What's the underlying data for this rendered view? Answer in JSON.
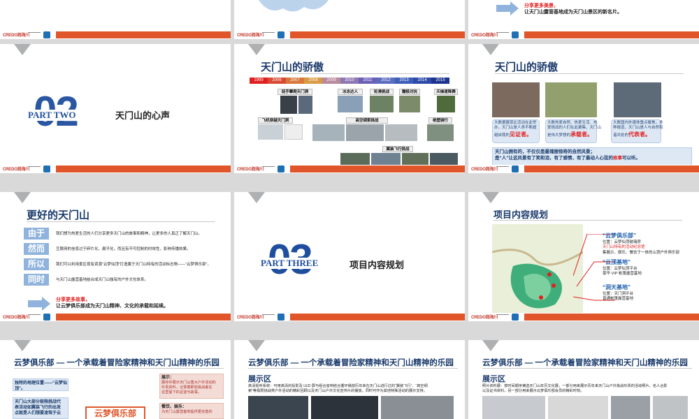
{
  "row1": {
    "s3_text": [
      "分享更多美景，",
      "让天门山露营基地成为天门山景区的新名片。"
    ],
    "s3_hl": "新名片"
  },
  "footer": {
    "logo": "CREDO润海川"
  },
  "s4": {
    "part": "PART TWO",
    "num": "02",
    "title": "天门山的心声"
  },
  "s5": {
    "title": "天门山的骄傲",
    "years": [
      "1999",
      "2006",
      "2007",
      "2008",
      "2009",
      "2010",
      "2011",
      "2012",
      "2013",
      "2014",
      "2015"
    ],
    "labels": [
      "徒手攀爬天门洞",
      "冰冻达人",
      "轮滑挑战",
      "蹦极对抗",
      "天梯速降赛",
      "飞机穿越天门洞",
      "高空绸索挑战",
      "绝壁骑行",
      "翼装飞行挑战"
    ]
  },
  "s6": {
    "title": "天门山的骄傲",
    "cap1": [
      "大数据展现比活动在此举",
      "办，天门山是人类不断超",
      "越自我的"
    ],
    "cap1_hl": "见证者。",
    "cap2": [
      "大数热爱自然、热爱生活、热",
      "爱挑战的人们在此聚集，天门山",
      "是伟大梦想的"
    ],
    "cap2_hl": "承载者。",
    "cap3": [
      "大数国内外媒体重点聚焦，多",
      "种报道，天门山是人与自然和",
      "谐共处的"
    ],
    "cap3_hl": "代表者。",
    "summary1": "天门山拥有的，不仅仅是最瑰丽惊奇的自然风景；",
    "summary2": "是“人”让这风景有了笑和泪，有了感情，有了最动人心弦的",
    "summary_hl": "故事",
    "summary_end": "可以听。"
  },
  "s7": {
    "title": "更好的天门山",
    "side": [
      "由于",
      "然而",
      "所以",
      "同时"
    ],
    "lines": [
      "我们想为热爱生活的人们分享更多天门山的故事和精神，让更多的人真正了解天门山。",
      "互联网的信息过于碎片化、扁平化，而且有不可控制的时效性，影响传播效果。",
      "我们可以利用景区现有资源“云梦仙顶”打造属于天门山特有的活动标志物——“云梦俱乐部”，",
      "与天门山露营基地结合成天门山独有的户外文化体系。"
    ],
    "share1": "分享更多故事，",
    "share2": "让云梦俱乐部成为天门山精神、文化的承载和延续。"
  },
  "s8": {
    "part": "PART THREE",
    "num": "03",
    "title": "项目内容规划"
  },
  "s9": {
    "title": "项目内容规划",
    "a_title": "“云梦俱乐部”",
    "a1": "位置：云梦仙顶玻璃房",
    "a2": "天门山特有的活动纪念馆",
    "a3": "集展示、娱乐、餐饮于一体的山顶户外俱乐部",
    "b_title": "“云顶基地”",
    "b1": "位置：云梦仙顶平台",
    "b2": "豪华 VIP 帐篷露营基地",
    "c_title": "“洞天基地”",
    "c1": "位置：天门洞平台",
    "c2": "普通帐篷露营基地"
  },
  "s10": {
    "title": "云梦俱乐部 — 一个承载着冒险家精神和天门山精神的乐园",
    "l1": "独特的地理位置——“云梦仙顶”。",
    "l2": [
      "天门山大部分极限挑战代",
      "表活动如翼装飞行的出发",
      "点就是人们想要凌驾于云"
    ],
    "center": "云梦俱乐部",
    "r1_t": "展示：",
    "r1": [
      "展存并展示天门山重大户外活动的",
      "珍贵资料，记录着那些挑战者在",
      "这里留下的足迹与故事。"
    ],
    "r2_t": "餐饮、娱乐：",
    "r2": [
      "为天门山露营基地提供更完善的"
    ]
  },
  "s11": {
    "title": "云梦俱乐部 — 一个承载着冒险家精神和天门山精神的乐园",
    "sub": "展示区",
    "body": [
      "高清视听系统：可用高清的投影及 LED 屏与组合音响结合循环播放历年来在天门山进行过的“翼装飞行”、“高空绸",
      "索”等极限挑战类户外活动的精彩回顾以及天门山户外文化宣传片的播放。同时可作为其他特殊活动的展示支持。"
    ]
  },
  "s12": {
    "title": "云梦俱乐部 — 一个承载着冒险家精神和天门山精神的乐园",
    "sub": "展示区",
    "body": [
      "照片资料展：按时间顺序摘选天门山年历文化展，一部分用来展示历年来天门山户外挑战珍贵的活动照片、名人合影",
      "以及证书资料，另一部分用来展示云梦俱乐部会员的精彩时刻。"
    ]
  }
}
